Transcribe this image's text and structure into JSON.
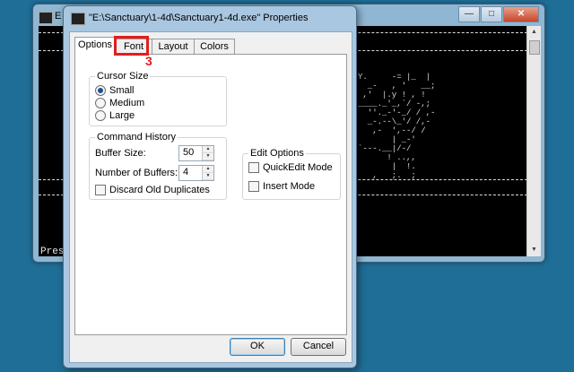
{
  "console": {
    "title_fragment": "E",
    "minimize_icon": "minimize-icon",
    "maximize_icon": "maximize-icon",
    "close_icon": "close-icon",
    "press_text": "Pres",
    "ascii_art": "Y.     -= |_  |\n  _-   , '   __;\n ,'  |.y ! , !\n____._'_,`/ -,;\n  ''._-'-_/ / ,-\n  _-.--\\_'/ /,-\n   ,-  ',--/ /\n       | _-'  \n`---.__|/-/\n      ! ..,,\n       |  !.\n   ,   ;.  ;"
  },
  "dialog": {
    "title": "\"E:\\Sanctuary\\1-4d\\Sanctuary1-4d.exe\" Properties",
    "tabs": [
      {
        "label": "Options"
      },
      {
        "label": "Font"
      },
      {
        "label": "Layout"
      },
      {
        "label": "Colors"
      }
    ],
    "annotation_number": "3",
    "cursor_size": {
      "legend": "Cursor Size",
      "options": [
        {
          "label": "Small",
          "selected": true
        },
        {
          "label": "Medium",
          "selected": false
        },
        {
          "label": "Large",
          "selected": false
        }
      ]
    },
    "command_history": {
      "legend": "Command History",
      "buffer_size_label": "Buffer Size:",
      "buffer_size_value": "50",
      "num_buffers_label": "Number of Buffers:",
      "num_buffers_value": "4",
      "discard_label": "Discard Old Duplicates",
      "discard_checked": false
    },
    "edit_options": {
      "legend": "Edit Options",
      "quickedit_label": "QuickEdit Mode",
      "quickedit_checked": false,
      "insert_label": "Insert Mode",
      "insert_checked": false
    },
    "ok_label": "OK",
    "cancel_label": "Cancel"
  },
  "colors": {
    "desktop": "#1f6e97",
    "annotation": "#e01e1e"
  }
}
